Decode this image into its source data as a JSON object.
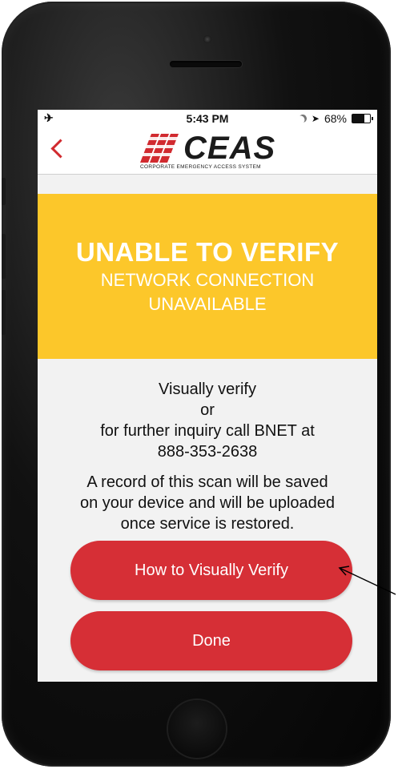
{
  "status_bar": {
    "airplane_icon": "airplane-icon",
    "time": "5:43 PM",
    "battery": "68%",
    "battery_level": 0.68
  },
  "nav": {
    "back_icon": "chevron-left-icon",
    "logo_text": "CEAS",
    "logo_tagline": "CORPORATE EMERGENCY ACCESS SYSTEM"
  },
  "banner": {
    "title": "UNABLE TO VERIFY",
    "subtitle_line1": "NETWORK CONNECTION",
    "subtitle_line2": "UNAVAILABLE",
    "color": "#fcc72a"
  },
  "message": {
    "line1": "Visually verify",
    "line2": "or",
    "line3": "for further inquiry call BNET at",
    "phone": "888-353-2638",
    "record_line1": "A record of this scan will be saved",
    "record_line2": "on your device and will be uploaded",
    "record_line3": "once service is restored."
  },
  "buttons": {
    "how_to_verify": "How to Visually Verify",
    "done": "Done",
    "color": "#d62f36"
  }
}
